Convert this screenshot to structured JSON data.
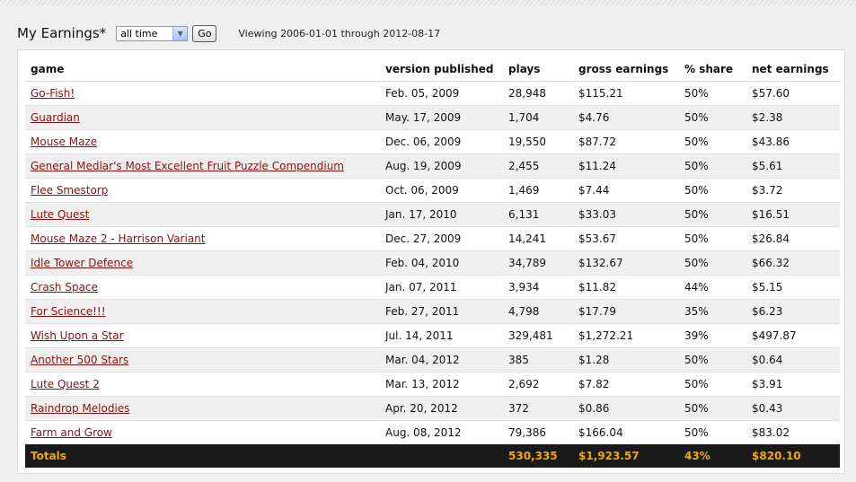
{
  "header": {
    "title": "My Earnings*",
    "range_select_value": "all time",
    "go_label": "Go",
    "viewing_text": "Viewing 2006-01-01 through 2012-08-17"
  },
  "table": {
    "columns": [
      "game",
      "version published",
      "plays",
      "gross earnings",
      "% share",
      "net earnings"
    ],
    "rows": [
      {
        "game": "Go-Fish!",
        "published": "Feb. 05, 2009",
        "plays": "28,948",
        "gross": "$115.21",
        "share": "50%",
        "net": "$57.60"
      },
      {
        "game": "Guardian",
        "published": "May. 17, 2009",
        "plays": "1,704",
        "gross": "$4.76",
        "share": "50%",
        "net": "$2.38"
      },
      {
        "game": "Mouse Maze",
        "published": "Dec. 06, 2009",
        "plays": "19,550",
        "gross": "$87.72",
        "share": "50%",
        "net": "$43.86"
      },
      {
        "game": "General Medlar's Most Excellent Fruit Puzzle Compendium",
        "published": "Aug. 19, 2009",
        "plays": "2,455",
        "gross": "$11.24",
        "share": "50%",
        "net": "$5.61"
      },
      {
        "game": "Flee Smestorp",
        "published": "Oct. 06, 2009",
        "plays": "1,469",
        "gross": "$7.44",
        "share": "50%",
        "net": "$3.72"
      },
      {
        "game": "Lute Quest",
        "published": "Jan. 17, 2010",
        "plays": "6,131",
        "gross": "$33.03",
        "share": "50%",
        "net": "$16.51"
      },
      {
        "game": "Mouse Maze 2 - Harrison Variant",
        "published": "Dec. 27, 2009",
        "plays": "14,241",
        "gross": "$53.67",
        "share": "50%",
        "net": "$26.84"
      },
      {
        "game": "Idle Tower Defence",
        "published": "Feb. 04, 2010",
        "plays": "34,789",
        "gross": "$132.67",
        "share": "50%",
        "net": "$66.32"
      },
      {
        "game": "Crash Space",
        "published": "Jan. 07, 2011",
        "plays": "3,934",
        "gross": "$11.82",
        "share": "44%",
        "net": "$5.15"
      },
      {
        "game": "For Science!!!",
        "published": "Feb. 27, 2011",
        "plays": "4,798",
        "gross": "$17.79",
        "share": "35%",
        "net": "$6.23"
      },
      {
        "game": "Wish Upon a Star",
        "published": "Jul. 14, 2011",
        "plays": "329,481",
        "gross": "$1,272.21",
        "share": "39%",
        "net": "$497.87"
      },
      {
        "game": "Another 500 Stars",
        "published": "Mar. 04, 2012",
        "plays": "385",
        "gross": "$1.28",
        "share": "50%",
        "net": "$0.64"
      },
      {
        "game": "Lute Quest 2",
        "published": "Mar. 13, 2012",
        "plays": "2,692",
        "gross": "$7.82",
        "share": "50%",
        "net": "$3.91"
      },
      {
        "game": "Raindrop Melodies",
        "published": "Apr. 20, 2012",
        "plays": "372",
        "gross": "$0.86",
        "share": "50%",
        "net": "$0.43"
      },
      {
        "game": "Farm and Grow",
        "published": "Aug. 08, 2012",
        "plays": "79,386",
        "gross": "$166.04",
        "share": "50%",
        "net": "$83.02"
      }
    ],
    "totals": {
      "label": "Totals",
      "plays": "530,335",
      "gross": "$1,923.57",
      "share": "43%",
      "net": "$820.10"
    }
  },
  "colors": {
    "link": "#8b1010",
    "totals_bg": "#1a1a1a",
    "totals_text": "#f5a800",
    "alt_row": "#f0f0f0"
  },
  "icons": {
    "dropdown": "chevron-down-icon"
  }
}
